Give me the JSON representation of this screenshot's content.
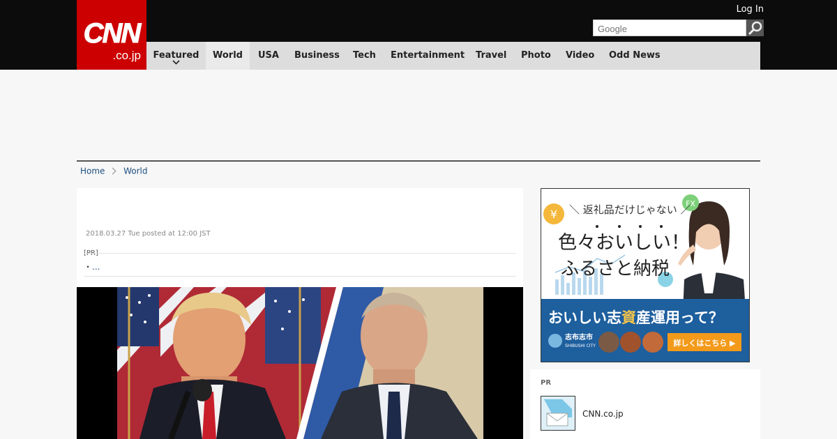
{
  "header": {
    "logo_main": "CNN",
    "logo_sub": ".co.jp",
    "login_label": "Log In",
    "search_placeholder": "Google"
  },
  "nav": {
    "items": [
      {
        "label": "Featured"
      },
      {
        "label": "World"
      },
      {
        "label": "USA"
      },
      {
        "label": "Business"
      },
      {
        "label": "Tech"
      },
      {
        "label": "Entertainment"
      },
      {
        "label": "Travel"
      },
      {
        "label": "Photo"
      },
      {
        "label": "Video"
      },
      {
        "label": "Odd News"
      }
    ],
    "active": "World"
  },
  "breadcrumb": {
    "home": "Home",
    "current": "World"
  },
  "article": {
    "date": "2018.03.27 Tue posted at 12:00 JST",
    "pr_label": "[PR]",
    "bullet_marker": "・",
    "pr_link": "..."
  },
  "ad": {
    "tagline": "＼ 返礼品だけじゃない ／",
    "headline_1": "色々おいしい！",
    "headline_2": "ふるさと納税",
    "bottom_prefix": "おいしい志",
    "bottom_badge": "資",
    "bottom_suffix": "産運用って？",
    "city": "志布志市",
    "city_en": "SHIBUSHI CITY",
    "cta": "詳しくはこちら ▶",
    "badge_fx": "FX",
    "badge_yen": "¥"
  },
  "sidebar_pr": {
    "title": "PR",
    "item_name": "CNN.co.jp"
  },
  "colors": {
    "brand_red": "#cc0000",
    "topbar": "#0c0c0c",
    "nav_bg": "#dddddd",
    "link": "#1d4f7e",
    "ad_blue": "#1e5f9e",
    "cta_orange": "#f39a1a"
  },
  "icons": {
    "search": "magnifier-icon",
    "dropdown": "chevron-down-icon",
    "breadcrumb_sep": "chevron-right-icon"
  }
}
